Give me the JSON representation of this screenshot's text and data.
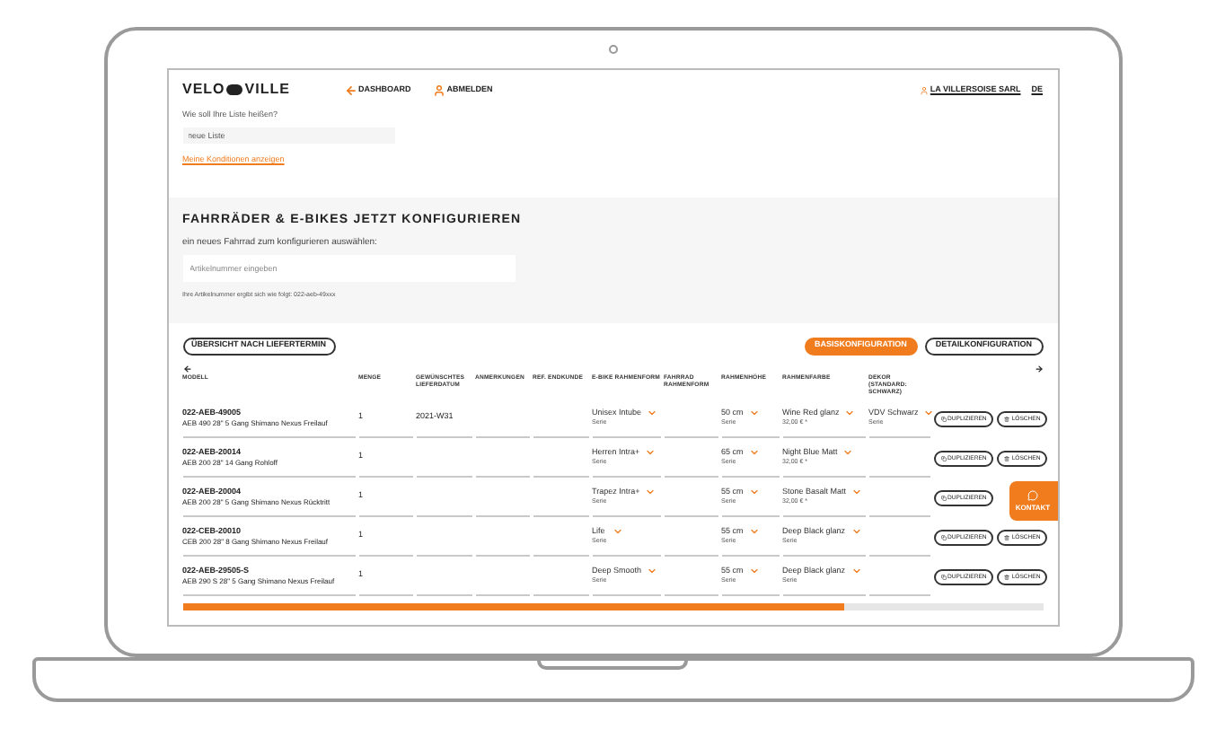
{
  "header": {
    "logo": {
      "left": "VELO",
      "right": "VILLE"
    },
    "nav": [
      {
        "label": "DASHBOARD",
        "kind": "back"
      },
      {
        "label": "ABMELDEN",
        "kind": "logout"
      }
    ],
    "account": "LA VILLERSOISE SARL",
    "language": "DE"
  },
  "list_form": {
    "label": "Wie soll Ihre Liste heißen?",
    "value": "neue Liste",
    "link": "Meine Konditionen anzeigen"
  },
  "configure": {
    "title": "FAHRRÄDER & E-BIKES JETZT KONFIGURIEREN",
    "subtitle": "ein neues Fahrrad zum konfigurieren auswählen:",
    "placeholder": "Artikelnummer eingeben",
    "hint": "Ihre Artikelnummer ergibt sich wie folgt: 022-aeb-49xxx"
  },
  "toolbar": {
    "overview_button": "ÜBERSICHT NACH LIEFERTERMIN",
    "tabs": [
      {
        "label": "BASISKONFIGURATION",
        "selected": true
      },
      {
        "label": "DETAILKONFIGURATION",
        "selected": false
      }
    ]
  },
  "table": {
    "columns": [
      "MODELL",
      "MENGE",
      "GEWÜNSCHTES LIEFERDATUM",
      "ANMERKUNGEN",
      "REF. ENDKUNDE",
      "E-BIKE RAHMENFORM",
      "FAHRRAD RAHMENFORM",
      "RAHMENHÖHE",
      "RAHMENFARBE",
      "DEKOR (STANDARD: SCHWARZ)"
    ],
    "rows": [
      {
        "code": "022-AEB-49005",
        "name": "AEB 490 28\" 5 Gang Shimano Nexus Freilauf",
        "quantity": "1",
        "date": "2021-W31",
        "ebike_frame": {
          "value": "Unisex Intube",
          "note": "Serie"
        },
        "frame_height": {
          "value": "50 cm",
          "note": "Serie"
        },
        "frame_color": {
          "value": "Wine Red glanz",
          "note": "32,00 € *"
        },
        "decor": {
          "value": "VDV Schwarz",
          "note": "Serie"
        },
        "actions": [
          "DUPLIZIEREN",
          "LÖSCHEN"
        ]
      },
      {
        "code": "022-AEB-20014",
        "name": "AEB 200 28\" 14 Gang Rohloff",
        "quantity": "1",
        "ebike_frame": {
          "value": "Herren Intra+",
          "note": "Serie"
        },
        "frame_height": {
          "value": "65 cm",
          "note": "Serie"
        },
        "frame_color": {
          "value": "Night Blue Matt",
          "note": "32,00 € *"
        },
        "actions": [
          "DUPLIZIEREN",
          "LÖSCHEN"
        ]
      },
      {
        "code": "022-AEB-20004",
        "name": "AEB 200 28\" 5 Gang Shimano Nexus Rücktritt",
        "quantity": "1",
        "ebike_frame": {
          "value": "Trapez Intra+",
          "note": "Serie"
        },
        "frame_height": {
          "value": "55 cm",
          "note": "Serie"
        },
        "frame_color": {
          "value": "Stone Basalt Matt",
          "note": "32,00 € *"
        },
        "actions": [
          "DUPLIZIEREN"
        ]
      },
      {
        "code": "022-CEB-20010",
        "name": "CEB 200 28\" 8 Gang Shimano Nexus Freilauf",
        "quantity": "1",
        "ebike_frame": {
          "value": "Life",
          "note": "Serie"
        },
        "frame_height": {
          "value": "55 cm",
          "note": "Serie"
        },
        "frame_color": {
          "value": "Deep Black glanz",
          "note": "Serie"
        },
        "actions": [
          "DUPLIZIEREN",
          "LÖSCHEN"
        ]
      },
      {
        "code": "022-AEB-29505-S",
        "name": "AEB 290 S 28\" 5 Gang Shimano Nexus Freilauf",
        "quantity": "1",
        "ebike_frame": {
          "value": "Deep Smooth",
          "note": "Serie"
        },
        "frame_height": {
          "value": "55 cm",
          "note": "Serie"
        },
        "frame_color": {
          "value": "Deep Black glanz",
          "note": "Serie"
        },
        "actions": [
          "DUPLIZIEREN",
          "LÖSCHEN"
        ]
      }
    ]
  },
  "contact_button": "KONTAKT"
}
